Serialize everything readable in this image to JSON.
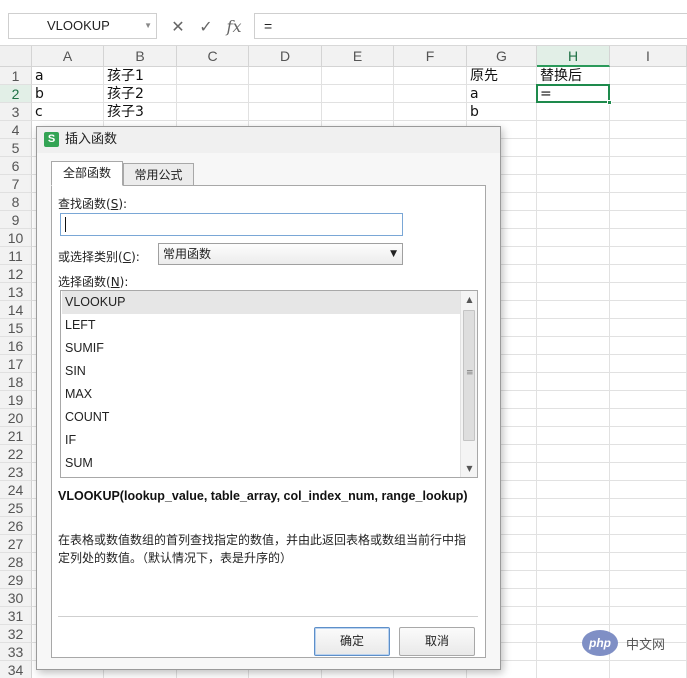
{
  "formula_bar": {
    "name_box": "VLOOKUP",
    "cancel_icon": "✕",
    "confirm_icon": "✓",
    "fx_icon": "fx",
    "formula": "="
  },
  "sheet": {
    "columns": [
      "A",
      "B",
      "C",
      "D",
      "E",
      "F",
      "G",
      "H",
      "I"
    ],
    "selected_column": "H",
    "rows": [
      "1",
      "2",
      "3",
      "4",
      "5",
      "6",
      "7",
      "8",
      "9",
      "10",
      "11",
      "12",
      "13",
      "14",
      "15",
      "16",
      "17",
      "18",
      "19",
      "20",
      "21",
      "22",
      "23",
      "24",
      "25",
      "26",
      "27",
      "28",
      "29",
      "30",
      "31",
      "32",
      "33",
      "34"
    ],
    "selected_row": "2",
    "cells": {
      "A1": "a",
      "B1": "孩子1",
      "G1": "原先",
      "H1": "替换后",
      "A2": "b",
      "B2": "孩子2",
      "G2": "a",
      "H2": "=",
      "A3": "c",
      "B3": "孩子3",
      "G3": "b"
    },
    "active_cell": "H2",
    "accent_color": "#1e8a4c"
  },
  "dialog": {
    "title": "插入函数",
    "logo_letter": "S",
    "tabs": [
      {
        "label": "全部函数",
        "active": true
      },
      {
        "label": "常用公式",
        "active": false
      }
    ],
    "search_label": "查找函数(",
    "search_hotkey": "S",
    "search_label_end": "):",
    "search_value": "",
    "category_label": "或选择类别(",
    "category_hotkey": "C",
    "category_label_end": "):",
    "category_value": "常用函数",
    "functions_label": "选择函数(",
    "functions_hotkey": "N",
    "functions_label_end": "):",
    "functions": [
      "VLOOKUP",
      "LEFT",
      "SUMIF",
      "SIN",
      "MAX",
      "COUNT",
      "IF",
      "SUM"
    ],
    "selected_function": "VLOOKUP",
    "signature": "VLOOKUP(lookup_value, table_array, col_index_num, range_lookup)",
    "description": "在表格或数值数组的首列查找指定的数值，并由此返回表格或数组当前行中指定列处的数值。（默认情况下，表是升序的）",
    "ok_label": "确定",
    "cancel_label": "取消"
  },
  "watermark": {
    "logo_text": "php",
    "site_text": "中文网"
  }
}
